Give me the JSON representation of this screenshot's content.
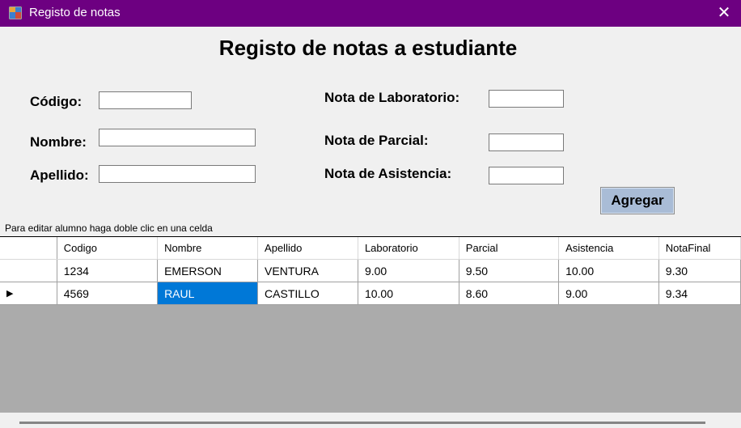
{
  "window": {
    "title": "Registo de notas",
    "close_symbol": "✕"
  },
  "form": {
    "heading": "Registo de notas a estudiante",
    "codigo_label": "Código:",
    "nombre_label": "Nombre:",
    "apellido_label": "Apellido:",
    "laboratorio_label": "Nota de Laboratorio:",
    "parcial_label": "Nota de Parcial:",
    "asistencia_label": "Nota de Asistencia:",
    "codigo_value": "",
    "nombre_value": "",
    "apellido_value": "",
    "laboratorio_value": "",
    "parcial_value": "",
    "asistencia_value": "",
    "agregar_label": "Agregar",
    "hint": "Para editar alumno haga doble clic en una celda"
  },
  "grid": {
    "columns": [
      "Codigo",
      "Nombre",
      "Apellido",
      "Laboratorio",
      "Parcial",
      "Asistencia",
      "NotaFinal"
    ],
    "rows": [
      {
        "indicator": "",
        "cells": [
          "1234",
          "EMERSON",
          "VENTURA",
          "9.00",
          "9.50",
          "10.00",
          "9.30"
        ]
      },
      {
        "indicator": "▶",
        "cells": [
          "4569",
          "RAUL",
          "CASTILLO",
          "10.00",
          "8.60",
          "9.00",
          "9.34"
        ]
      }
    ],
    "selected_cell": "RAUL"
  },
  "colors": {
    "titlebar": "#6d0081",
    "selection": "#0078d7",
    "grid_background": "#ababab",
    "button": "#a9bcd6"
  }
}
